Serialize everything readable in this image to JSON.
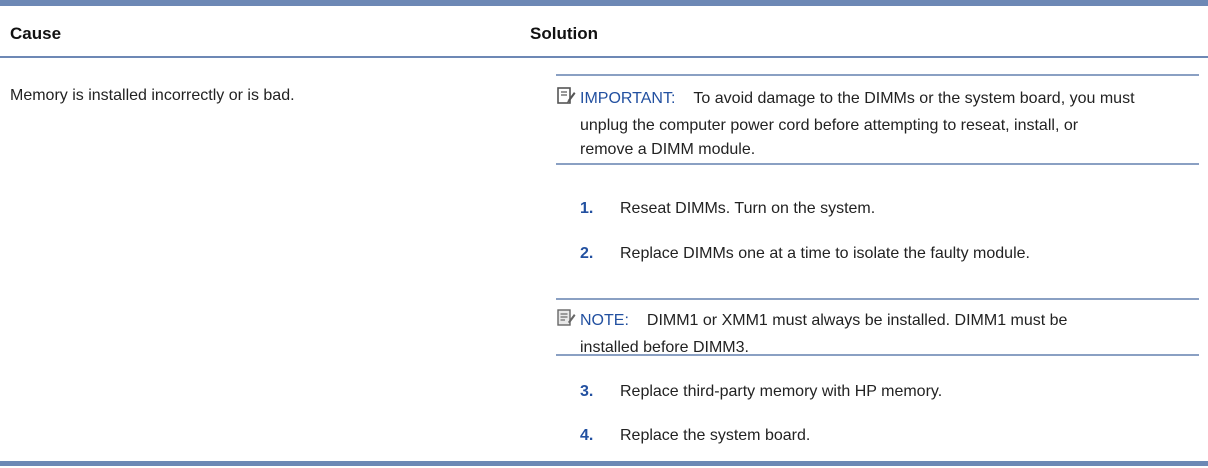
{
  "table": {
    "headers": {
      "cause": "Cause",
      "solution": "Solution"
    },
    "rows": [
      {
        "cause": "Memory is installed incorrectly or is bad.",
        "important": {
          "label": "IMPORTANT:",
          "line1": "To avoid damage to the DIMMs or the system board, you must",
          "line2": "unplug the computer power cord before attempting to reseat, install, or",
          "line3": "remove a DIMM module."
        },
        "steps": [
          {
            "num": "1.",
            "text": "Reseat DIMMs. Turn on the system."
          },
          {
            "num": "2.",
            "text": "Replace DIMMs one at a time to isolate the faulty module."
          },
          {
            "num": "3.",
            "text": "Replace third-party memory with HP memory."
          },
          {
            "num": "4.",
            "text": "Replace the system board."
          }
        ],
        "note": {
          "label": "NOTE:",
          "line1": "DIMM1 or XMM1 must always be installed. DIMM1 must be",
          "line2": "installed before DIMM3."
        }
      }
    ]
  },
  "colors": {
    "rule": "#6d88b5",
    "accent": "#2250a0"
  },
  "icons": {
    "important": "important-icon",
    "note": "note-icon"
  }
}
